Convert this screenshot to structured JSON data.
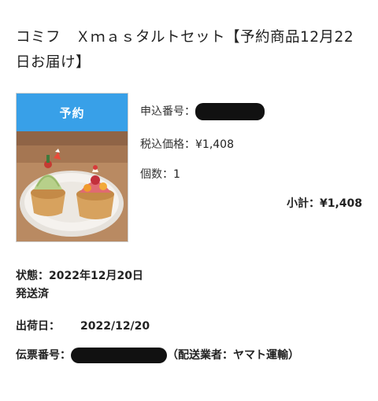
{
  "product": {
    "title": "コミフ　Ｘｍａｓタルトセット【予約商品12月22日お届け】",
    "reserve_label": "予約",
    "image_icon": "xmas-tart-photo"
  },
  "details": {
    "order_number_label": "申込番号：",
    "price_label": "税込価格：",
    "price_value": "¥1,408",
    "quantity_label": "個数：",
    "quantity_value": "1",
    "subtotal_label": "小計：",
    "subtotal_value": "¥1,408"
  },
  "status": {
    "label": "状態：",
    "date": "2022年12月20日",
    "state": "発送済"
  },
  "shipping": {
    "ship_date_label": "出荷日：",
    "ship_date_value": "2022/12/20",
    "tracking_label": "伝票番号：",
    "carrier_text": "（配送業者：ヤマト運輸）"
  },
  "colors": {
    "reserve_banner": "#38a0e8",
    "redaction": "#111111"
  }
}
